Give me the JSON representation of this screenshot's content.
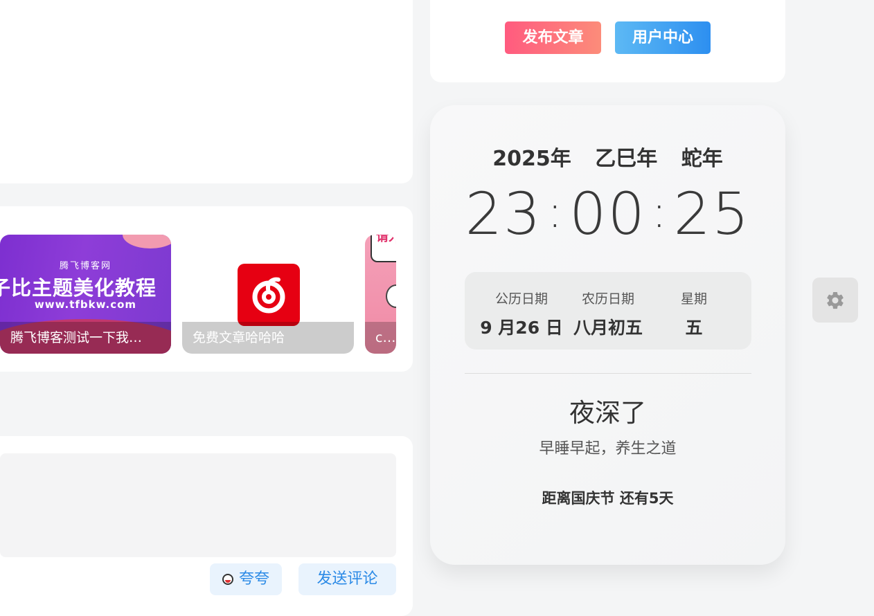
{
  "posts": {
    "items": [
      {
        "banner_site": "腾飞博客网",
        "banner_title": "子比主题美化教程",
        "banner_url": "www.tfbkw.com",
        "caption": "腾飞博客测试一下我…"
      },
      {
        "logo_icon": "netease-music-icon",
        "caption": "免费文章哈哈哈"
      },
      {
        "banner_text": "请入",
        "caption": "c对"
      }
    ]
  },
  "comment": {
    "praise_label": "夸夸",
    "send_label": "发送评论"
  },
  "user_card": {
    "publish_label": "发布文章",
    "user_center_label": "用户中心",
    "colors": {
      "publish_start": "#ff5b7f",
      "publish_end": "#fc8c7a",
      "user_center_start": "#5db9f4",
      "user_center_end": "#2d8ff0"
    }
  },
  "clock": {
    "year": "2025年",
    "ganzhi_year": "乙巳年",
    "zodiac_year": "蛇年",
    "hours": "23",
    "minutes": "00",
    "seconds": "25",
    "separator": ":",
    "dates": [
      {
        "label": "公历日期",
        "value": "9 月26 日"
      },
      {
        "label": "农历日期",
        "value": "八月初五"
      },
      {
        "label": "星期",
        "value": "五"
      }
    ],
    "greeting": "夜深了",
    "tip": "早睡早起，养生之道",
    "holiday_countdown": "距离国庆节 还有5天"
  },
  "settings": {
    "icon": "gear-icon"
  }
}
